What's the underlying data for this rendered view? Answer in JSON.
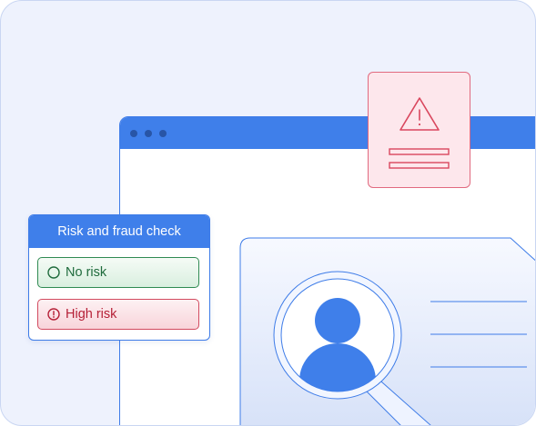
{
  "risk_panel": {
    "title": "Risk and fraud check",
    "options": [
      {
        "label": "No risk",
        "icon": "circle-check-icon",
        "status": "ok",
        "color": "#1f6b3c"
      },
      {
        "label": "High risk",
        "icon": "alert-circle-icon",
        "status": "warning",
        "color": "#b51f36"
      }
    ]
  },
  "colors": {
    "accent": "#3f7fea",
    "background": "#eef2fd",
    "alert_fill": "#fde7ec",
    "alert_border": "#e16a7f"
  },
  "icons": {
    "alert_card": "warning-triangle-icon",
    "magnifier": "magnifying-glass-icon",
    "avatar": "user-avatar-icon"
  }
}
